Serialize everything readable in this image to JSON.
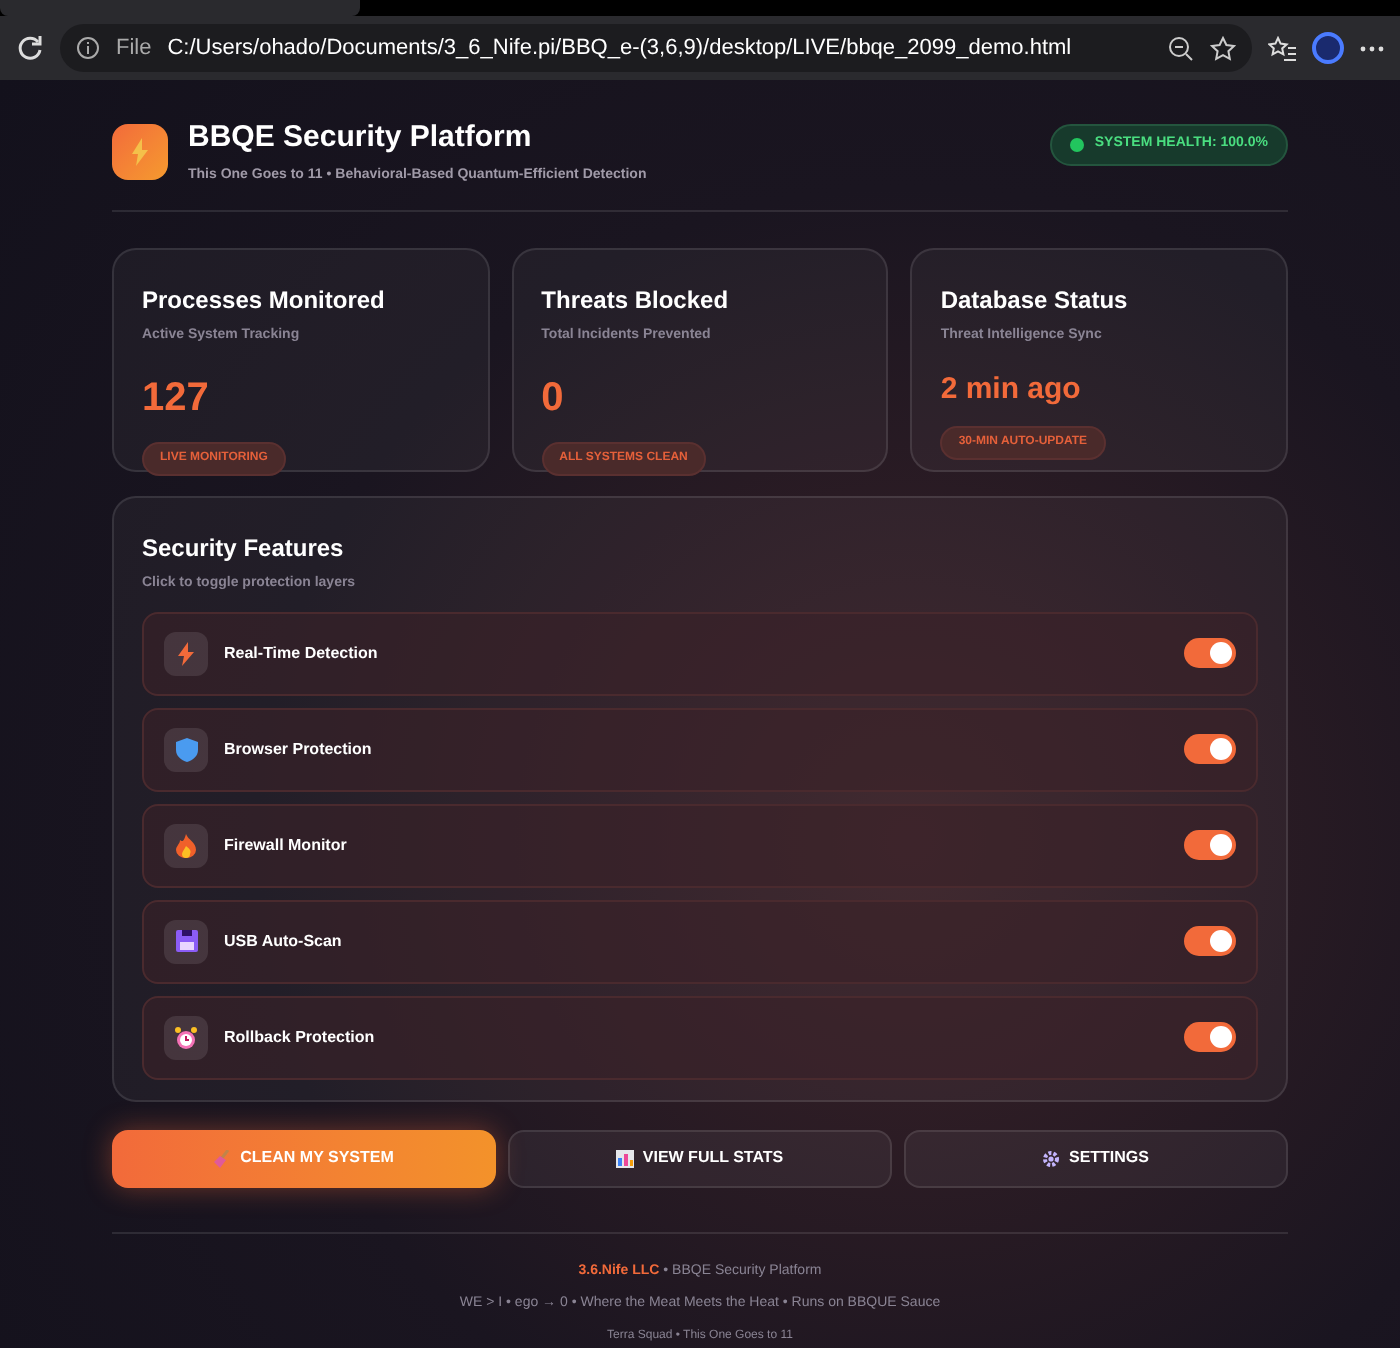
{
  "browser": {
    "file_label": "File",
    "url": "C:/Users/ohado/Documents/3_6_Nife.pi/BBQ_e-(3,6,9)/desktop/LIVE/bbqe_2099_demo.html"
  },
  "header": {
    "title": "BBQE Security Platform",
    "subtitle": "This One Goes to 11 • Behavioral-Based Quantum-Efficient Detection",
    "health": "SYSTEM HEALTH: 100.0%"
  },
  "stats": [
    {
      "title": "Processes Monitored",
      "subtitle": "Active System Tracking",
      "value": "127",
      "badge": "LIVE MONITORING"
    },
    {
      "title": "Threats Blocked",
      "subtitle": "Total Incidents Prevented",
      "value": "0",
      "badge": "ALL SYSTEMS CLEAN"
    },
    {
      "title": "Database Status",
      "subtitle": "Threat Intelligence Sync",
      "value": "2 min ago",
      "badge": "30-MIN AUTO-UPDATE"
    }
  ],
  "features": {
    "title": "Security Features",
    "subtitle": "Click to toggle protection layers",
    "items": [
      {
        "kind": "bolt",
        "label": "Real-Time Detection",
        "on": true
      },
      {
        "kind": "shield",
        "label": "Browser Protection",
        "on": true
      },
      {
        "kind": "flame",
        "label": "Firewall Monitor",
        "on": true
      },
      {
        "kind": "disk",
        "label": "USB Auto-Scan",
        "on": true
      },
      {
        "kind": "clock",
        "label": "Rollback Protection",
        "on": true
      }
    ]
  },
  "actions": [
    {
      "kind": "broom",
      "label": "CLEAN MY SYSTEM",
      "primary": true
    },
    {
      "kind": "chart",
      "label": "VIEW FULL STATS",
      "primary": false
    },
    {
      "kind": "gear",
      "label": "SETTINGS",
      "primary": false
    }
  ],
  "footer": {
    "company": "3.6.Nife LLC",
    "line1": "• BBQE Security Platform",
    "line2": "WE > I • ego → 0 • Where the Meat Meets the Heat • Runs on BBQUE Sauce",
    "line3": "Terra Squad • This One Goes to 11"
  }
}
